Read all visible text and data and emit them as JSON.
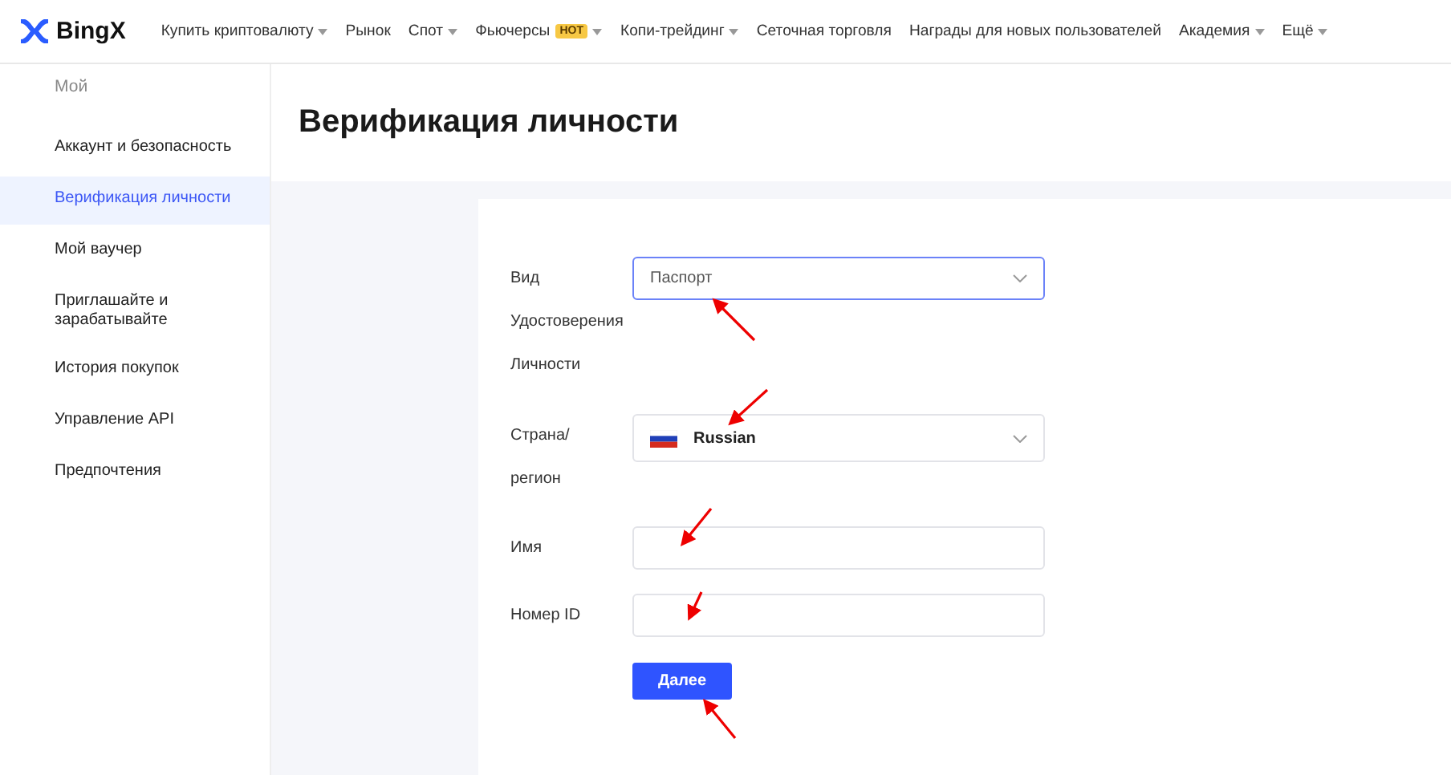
{
  "logo": {
    "text": "BingX"
  },
  "nav": [
    {
      "label": "Купить криптовалюту",
      "dropdown": true
    },
    {
      "label": "Рынок",
      "dropdown": false
    },
    {
      "label": "Спот",
      "dropdown": true
    },
    {
      "label": "Фьючерсы",
      "badge": "HOT",
      "dropdown": true
    },
    {
      "label": "Копи-трейдинг",
      "dropdown": true
    },
    {
      "label": "Сеточная торговля",
      "dropdown": false
    },
    {
      "label": "Награды для новых пользователей",
      "dropdown": false
    },
    {
      "label": "Академия",
      "dropdown": true
    },
    {
      "label": "Ещё",
      "dropdown": true
    }
  ],
  "sidebar": {
    "heading": "Мой",
    "items": [
      {
        "label": "Аккаунт и безопасность",
        "selected": false
      },
      {
        "label": "Верификация личности",
        "selected": true
      },
      {
        "label": "Мой ваучер",
        "selected": false
      },
      {
        "label": "Приглашайте и зарабатывайте",
        "selected": false
      },
      {
        "label": "История покупок",
        "selected": false
      },
      {
        "label": "Управление API",
        "selected": false
      },
      {
        "label": "Предпочтения",
        "selected": false
      }
    ]
  },
  "page_title": "Верификация личности",
  "form": {
    "fields": [
      {
        "kind": "select",
        "label_lines": [
          "Вид",
          "Удостоверения",
          "Личности"
        ],
        "value": "Паспорт",
        "focused": true
      },
      {
        "kind": "country",
        "label_lines": [
          "Страна/",
          "регион"
        ],
        "value": "Russian",
        "focused": false
      },
      {
        "kind": "input",
        "label_lines": [
          "Имя"
        ],
        "focused": false
      },
      {
        "kind": "input",
        "label_lines": [
          "Номер ID"
        ],
        "focused": false
      }
    ],
    "submit": "Далее"
  }
}
